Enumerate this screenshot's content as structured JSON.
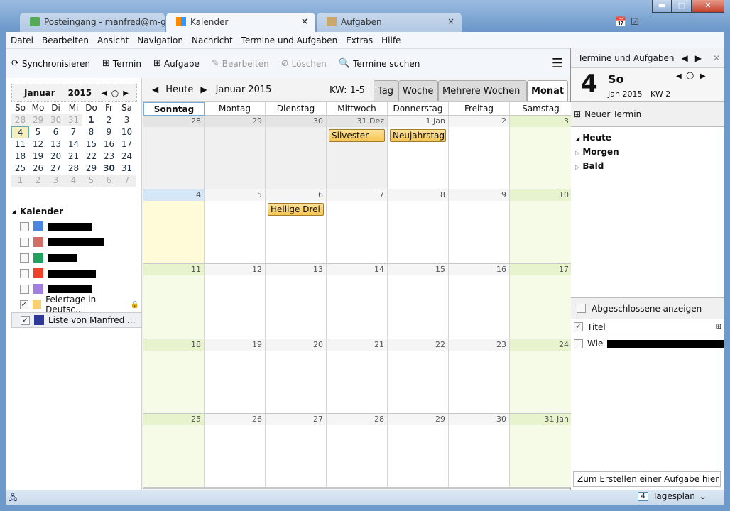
{
  "tabs": [
    {
      "label": "Posteingang - manfred@m-g...",
      "icon": "inbox-icon",
      "active": false
    },
    {
      "label": "Kalender",
      "icon": "calendar-icon",
      "active": true,
      "close": "×"
    },
    {
      "label": "Aufgaben",
      "icon": "tasks-icon",
      "active": false,
      "close": "×"
    }
  ],
  "window_controls": {
    "minimize": "▬",
    "maximize": "□",
    "close": "✕"
  },
  "menu": [
    "Datei",
    "Bearbeiten",
    "Ansicht",
    "Navigation",
    "Nachricht",
    "Termine und Aufgaben",
    "Extras",
    "Hilfe"
  ],
  "toolbar": {
    "sync": "Synchronisieren",
    "event": "Termin",
    "task": "Aufgabe",
    "edit": "Bearbeiten",
    "delete": "Löschen",
    "find": "Termine suchen",
    "menu_icon": "☰"
  },
  "minical": {
    "month": "Januar",
    "year": "2015",
    "dow": [
      "So",
      "Mo",
      "Di",
      "Mi",
      "Do",
      "Fr",
      "Sa"
    ],
    "weeks": [
      [
        "28",
        "29",
        "30",
        "31",
        "1",
        "2",
        "3"
      ],
      [
        "4",
        "5",
        "6",
        "7",
        "8",
        "9",
        "10"
      ],
      [
        "11",
        "12",
        "13",
        "14",
        "15",
        "16",
        "17"
      ],
      [
        "18",
        "19",
        "20",
        "21",
        "22",
        "23",
        "24"
      ],
      [
        "25",
        "26",
        "27",
        "28",
        "29",
        "30",
        "31"
      ],
      [
        "1",
        "2",
        "3",
        "4",
        "5",
        "6",
        "7"
      ]
    ]
  },
  "calendars": {
    "title": "Kalender",
    "items": [
      {
        "color": "#4a86e0",
        "checked": false,
        "name": "",
        "redacted": true
      },
      {
        "color": "#d06e66",
        "checked": false,
        "name": "",
        "redacted": true
      },
      {
        "color": "#22a060",
        "checked": false,
        "name": "",
        "redacted": true
      },
      {
        "color": "#f0402a",
        "checked": false,
        "name": "",
        "redacted": true
      },
      {
        "color": "#a07fe0",
        "checked": false,
        "name": "",
        "redacted": true
      },
      {
        "color": "#f8d070",
        "checked": true,
        "name": "Feiertage in Deutsc...",
        "locked": true
      },
      {
        "color": "#2e3899",
        "checked": true,
        "name": "Liste von Manfred ...",
        "selected": true
      }
    ]
  },
  "view": {
    "today": "Heute",
    "title": "Januar 2015",
    "kw": "KW: 1-5",
    "tabs": [
      "Tag",
      "Woche",
      "Mehrere Wochen",
      "Monat"
    ],
    "selected_tab": "Monat",
    "days": [
      "Sonntag",
      "Montag",
      "Dienstag",
      "Mittwoch",
      "Donnerstag",
      "Freitag",
      "Samstag"
    ],
    "weeks": [
      [
        {
          "d": "28",
          "o": 1
        },
        {
          "d": "29",
          "o": 1
        },
        {
          "d": "30",
          "o": 1
        },
        {
          "d": "31 Dez",
          "o": 1,
          "ev": "Silvester"
        },
        {
          "d": "1 Jan",
          "ev": "Neujahrstag"
        },
        {
          "d": "2"
        },
        {
          "d": "3"
        }
      ],
      [
        {
          "d": "4",
          "t": 1
        },
        {
          "d": "5"
        },
        {
          "d": "6",
          "ev": "Heilige Drei ..."
        },
        {
          "d": "7"
        },
        {
          "d": "8"
        },
        {
          "d": "9"
        },
        {
          "d": "10"
        }
      ],
      [
        {
          "d": "11"
        },
        {
          "d": "12"
        },
        {
          "d": "13"
        },
        {
          "d": "14"
        },
        {
          "d": "15"
        },
        {
          "d": "16"
        },
        {
          "d": "17"
        }
      ],
      [
        {
          "d": "18"
        },
        {
          "d": "19"
        },
        {
          "d": "20"
        },
        {
          "d": "21"
        },
        {
          "d": "22"
        },
        {
          "d": "23"
        },
        {
          "d": "24"
        }
      ],
      [
        {
          "d": "25"
        },
        {
          "d": "26"
        },
        {
          "d": "27"
        },
        {
          "d": "28"
        },
        {
          "d": "29"
        },
        {
          "d": "30"
        },
        {
          "d": "31 Jan"
        }
      ]
    ]
  },
  "today_pane": {
    "title": "Termine und Aufgaben",
    "day": "4",
    "weekday": "So",
    "monthyear": "Jan 2015",
    "kw": "KW 2",
    "new_event": "Neuer Termin",
    "groups": [
      "Heute",
      "Morgen",
      "Bald"
    ],
    "show_completed": "Abgeschlossene anzeigen",
    "col_title": "Titel",
    "task_prefix": "Wie",
    "new_task_placeholder": "Zum Erstellen einer Aufgabe hier klick"
  },
  "status": {
    "mode": "Tagesplan",
    "mode_day": "4"
  }
}
